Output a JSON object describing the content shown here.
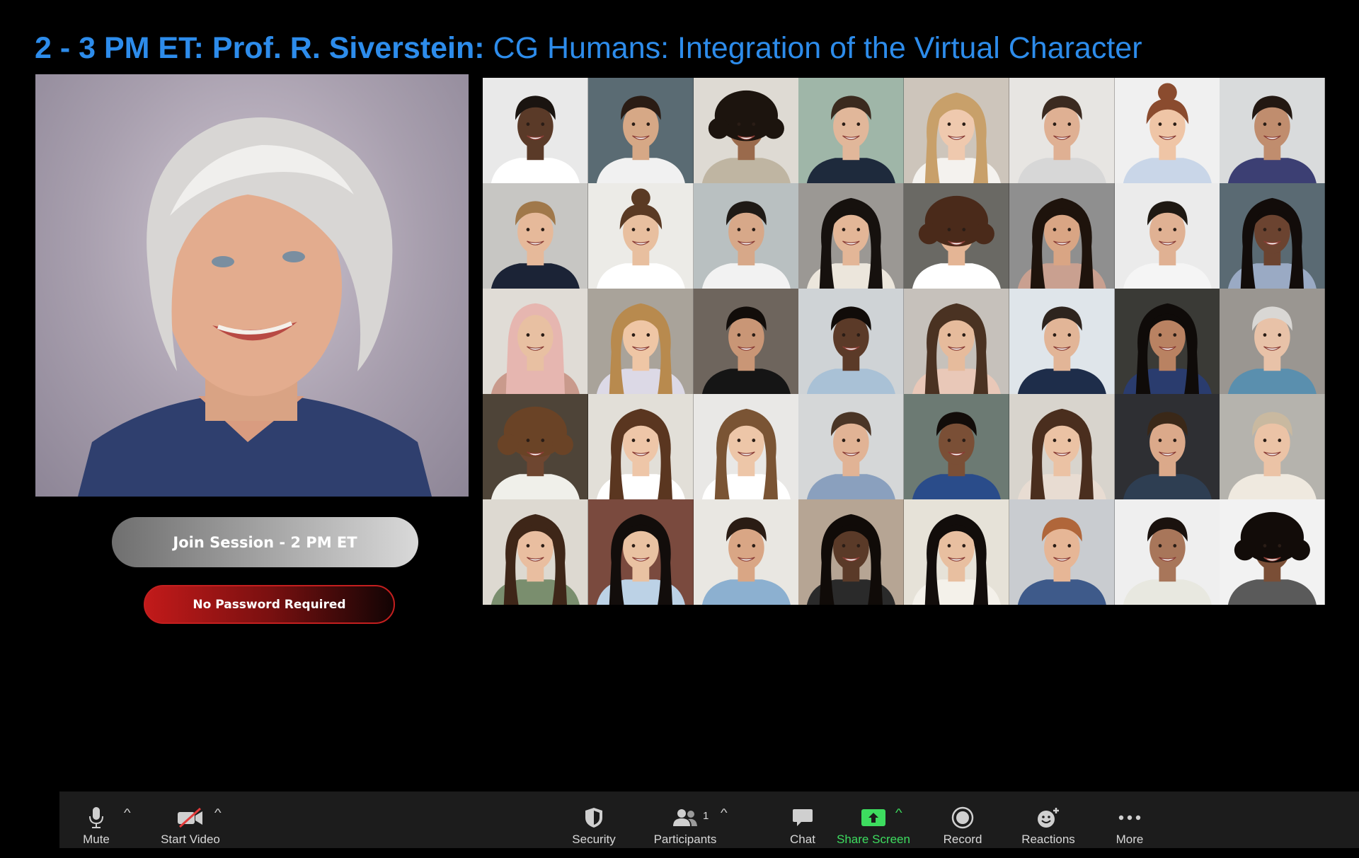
{
  "title": {
    "bold_part": "2 - 3 PM ET: Prof. R. Siverstein:",
    "regular_part": " CG Humans: Integration of the Virtual Character"
  },
  "speaker": {
    "name": "speaker-photo"
  },
  "buttons": {
    "join_label": "Join Session - 2 PM ET",
    "password_label": "No Password Required"
  },
  "colors": {
    "title_blue": "#2d8ceb",
    "share_green": "#3ddc5f",
    "password_red": "#c21a1a",
    "toolbar_bg": "#1c1c1c"
  },
  "participants_grid": {
    "rows": 5,
    "cols": 8,
    "tiles": [
      {
        "bg": "#e9e9e9",
        "skin": "#5a3a28",
        "hair": "#1a1410",
        "shirt": "#ffffff",
        "hairStyle": "short"
      },
      {
        "bg": "#5a6b73",
        "skin": "#d6a886",
        "hair": "#2a1c14",
        "shirt": "#f1f1f1",
        "hairStyle": "short"
      },
      {
        "bg": "#dedad3",
        "skin": "#9a6a4c",
        "hair": "#1c140e",
        "shirt": "#bfb5a2",
        "hairStyle": "curly"
      },
      {
        "bg": "#9fb6a8",
        "skin": "#e1b79a",
        "hair": "#3a2a1e",
        "shirt": "#1e2a3c",
        "hairStyle": "short"
      },
      {
        "bg": "#cdc5bb",
        "skin": "#efc9ae",
        "hair": "#c8a06a",
        "shirt": "#f4f2ee",
        "hairStyle": "long"
      },
      {
        "bg": "#e7e5e2",
        "skin": "#dfb093",
        "hair": "#3b2a20",
        "shirt": "#d7d7d7",
        "hairStyle": "short"
      },
      {
        "bg": "#f0f0f0",
        "skin": "#efc5a6",
        "hair": "#8a4b2e",
        "shirt": "#c9d6e8",
        "hairStyle": "bun"
      },
      {
        "bg": "#d9dbdc",
        "skin": "#c08d6e",
        "hair": "#231812",
        "shirt": "#3c3f73",
        "hairStyle": "short"
      },
      {
        "bg": "#c7c6c3",
        "skin": "#e6b99a",
        "hair": "#a0784a",
        "shirt": "#1b2336",
        "hairStyle": "short"
      },
      {
        "bg": "#ecebe7",
        "skin": "#e8bf9f",
        "hair": "#5a3a24",
        "shirt": "#ffffff",
        "hairStyle": "bun"
      },
      {
        "bg": "#b9c0c1",
        "skin": "#d7a889",
        "hair": "#1f1a16",
        "shirt": "#f2f2f2",
        "hairStyle": "short"
      },
      {
        "bg": "#9b9894",
        "skin": "#e3b697",
        "hair": "#16110e",
        "shirt": "#ece6dc",
        "hairStyle": "long"
      },
      {
        "bg": "#6a6964",
        "skin": "#e4b595",
        "hair": "#4a2a1a",
        "shirt": "#ffffff",
        "hairStyle": "curly"
      },
      {
        "bg": "#8f8f8f",
        "skin": "#d9a584",
        "hair": "#1e130c",
        "shirt": "#c9a090",
        "hairStyle": "long"
      },
      {
        "bg": "#ebebeb",
        "skin": "#e0b193",
        "hair": "#1e1812",
        "shirt": "#f5f5f5",
        "hairStyle": "short"
      },
      {
        "bg": "#5a6a73",
        "skin": "#6b4330",
        "hair": "#120c0a",
        "shirt": "#9aaac4",
        "hairStyle": "long"
      },
      {
        "bg": "#e0dcd6",
        "skin": "#e8c0a2",
        "hair": "#e6b6b0",
        "shirt": "#c99a8c",
        "hairStyle": "hijab"
      },
      {
        "bg": "#a9a39a",
        "skin": "#efc6a5",
        "hair": "#b88a4e",
        "shirt": "#dcd9e6",
        "hairStyle": "long"
      },
      {
        "bg": "#6e655d",
        "skin": "#c99676",
        "hair": "#120d0a",
        "shirt": "#151515",
        "hairStyle": "short"
      },
      {
        "bg": "#cfd3d6",
        "skin": "#5b3a28",
        "hair": "#110c09",
        "shirt": "#a9c1d6",
        "hairStyle": "short"
      },
      {
        "bg": "#c6c1bb",
        "skin": "#e6bb9c",
        "hair": "#4a3222",
        "shirt": "#e9c8b8",
        "hairStyle": "long"
      },
      {
        "bg": "#dfe5ea",
        "skin": "#e2b597",
        "hair": "#2e241e",
        "shirt": "#1e2d4a",
        "hairStyle": "short"
      },
      {
        "bg": "#3a3a36",
        "skin": "#b98262",
        "hair": "#0f0b09",
        "shirt": "#2a3c6e",
        "hairStyle": "long"
      },
      {
        "bg": "#9a9691",
        "skin": "#e8c2a8",
        "hair": "#d9d7d4",
        "shirt": "#5a8fae",
        "hairStyle": "short"
      },
      {
        "bg": "#4e4438",
        "skin": "#6e4630",
        "hair": "#6a4326",
        "shirt": "#f0f0ea",
        "hairStyle": "curly"
      },
      {
        "bg": "#e2dfd8",
        "skin": "#eec6a8",
        "hair": "#5a3620",
        "shirt": "#ffffff",
        "hairStyle": "long"
      },
      {
        "bg": "#e9e8e6",
        "skin": "#edc6a8",
        "hair": "#7a5434",
        "shirt": "#ffffff",
        "hairStyle": "long"
      },
      {
        "bg": "#d5d7d8",
        "skin": "#e1b395",
        "hair": "#4a3526",
        "shirt": "#8aa0be",
        "hairStyle": "short"
      },
      {
        "bg": "#6c7a73",
        "skin": "#7a4f36",
        "hair": "#120c09",
        "shirt": "#2a4c8a",
        "hairStyle": "short"
      },
      {
        "bg": "#d8d4cd",
        "skin": "#ebc2a4",
        "hair": "#4a2e1e",
        "shirt": "#e8dcd2",
        "hairStyle": "long"
      },
      {
        "bg": "#2e2f33",
        "skin": "#dba98a",
        "hair": "#3a2818",
        "shirt": "#2e3e52",
        "hairStyle": "short"
      },
      {
        "bg": "#b5b3ad",
        "skin": "#ebc3a6",
        "hair": "#c9b9a0",
        "shirt": "#efe9df",
        "hairStyle": "short"
      },
      {
        "bg": "#ddd9d1",
        "skin": "#e9bea0",
        "hair": "#3e2618",
        "shirt": "#7a8e6e",
        "hairStyle": "long"
      },
      {
        "bg": "#7a4a3e",
        "skin": "#e9c2a2",
        "hair": "#120d0b",
        "shirt": "#bcd2e6",
        "hairStyle": "long"
      },
      {
        "bg": "#e9e7e2",
        "skin": "#d9a685",
        "hair": "#2a1c14",
        "shirt": "#8cb0d0",
        "hairStyle": "short"
      },
      {
        "bg": "#b6a594",
        "skin": "#5a3a28",
        "hair": "#100b08",
        "shirt": "#2a2a2a",
        "hairStyle": "long"
      },
      {
        "bg": "#e6e2d8",
        "skin": "#e8bfa0",
        "hair": "#120d0b",
        "shirt": "#f4f1ea",
        "hairStyle": "long"
      },
      {
        "bg": "#c9ccd0",
        "skin": "#e6b696",
        "hair": "#b0663a",
        "shirt": "#3e5a8a",
        "hairStyle": "short"
      },
      {
        "bg": "#efefef",
        "skin": "#a8765a",
        "hair": "#1a120e",
        "shirt": "#e8e8e0",
        "hairStyle": "short"
      },
      {
        "bg": "#f2f2f2",
        "skin": "#7a4e36",
        "hair": "#120c09",
        "shirt": "#5a5a5a",
        "hairStyle": "curly"
      }
    ]
  },
  "toolbar": {
    "mute": "Mute",
    "start_video": "Start Video",
    "security": "Security",
    "participants": "Participants",
    "participants_count": "1",
    "chat": "Chat",
    "share_screen": "Share Screen",
    "record": "Record",
    "reactions": "Reactions",
    "more": "More",
    "icons": {
      "mute": "microphone-icon",
      "start_video": "video-off-icon",
      "security": "shield-icon",
      "participants": "people-icon",
      "chat": "chat-bubble-icon",
      "share_screen": "share-screen-icon",
      "record": "record-icon",
      "reactions": "emoji-plus-icon",
      "more": "ellipsis-icon"
    }
  }
}
